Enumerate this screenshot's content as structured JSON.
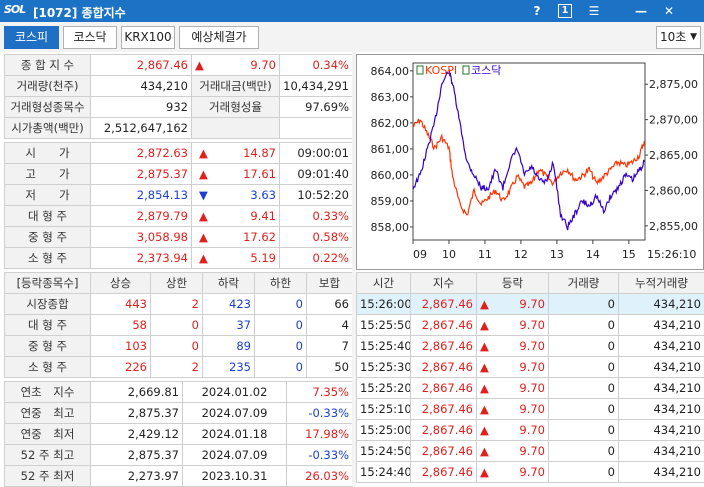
{
  "titlebar": {
    "logo": "SOL",
    "title": "[1072] 종합지수",
    "help": "?",
    "box": "1",
    "menu": "☰",
    "min": "—",
    "close": "✕"
  },
  "tabs": [
    "코스피",
    "코스닥",
    "KRX100",
    "예상체결가"
  ],
  "interval": "10초",
  "summary": [
    {
      "l1": "종 합 지 수",
      "v1": "2,867.46",
      "arrow": "▲",
      "v2": "9.70",
      "v3": "0.34%"
    },
    {
      "l1": "거래량(천주)",
      "v1": "434,210",
      "l2": "거래대금(백만)",
      "v2": "10,434,291"
    },
    {
      "l1": "거래형성종목수",
      "v1": "932",
      "l2": "거래형성율",
      "v2": "97.69%"
    },
    {
      "l1": "시가총액(백만)",
      "v1": "2,512,647,162"
    }
  ],
  "ohlc": [
    {
      "label": "시　　가",
      "value": "2,872.63",
      "arrow": "▲",
      "diff": "14.87",
      "extra": "09:00:01",
      "vc": "red",
      "ac": "red",
      "xc": ""
    },
    {
      "label": "고　　가",
      "value": "2,875.37",
      "arrow": "▲",
      "diff": "17.61",
      "extra": "09:01:40",
      "vc": "red",
      "ac": "red",
      "xc": ""
    },
    {
      "label": "저　　가",
      "value": "2,854.13",
      "arrow": "▼",
      "diff": "3.63",
      "extra": "10:52:20",
      "vc": "blue",
      "ac": "blue",
      "xc": ""
    },
    {
      "label": "대 형 주",
      "value": "2,879.79",
      "arrow": "▲",
      "diff": "9.41",
      "extra": "0.33%",
      "vc": "red",
      "ac": "red",
      "xc": "red"
    },
    {
      "label": "중 형 주",
      "value": "3,058.98",
      "arrow": "▲",
      "diff": "17.62",
      "extra": "0.58%",
      "vc": "red",
      "ac": "red",
      "xc": "red"
    },
    {
      "label": "소 형 주",
      "value": "2,373.94",
      "arrow": "▲",
      "diff": "5.19",
      "extra": "0.22%",
      "vc": "red",
      "ac": "red",
      "xc": "red"
    }
  ],
  "breadth": {
    "headers": [
      "[등락종목수]",
      "상승",
      "상한",
      "하락",
      "하한",
      "보합"
    ],
    "rows": [
      [
        "시장종합",
        "443",
        "2",
        "423",
        "0",
        "66"
      ],
      [
        "대 형 주",
        "58",
        "0",
        "37",
        "0",
        "4"
      ],
      [
        "중 형 주",
        "103",
        "0",
        "89",
        "0",
        "7"
      ],
      [
        "소 형 주",
        "226",
        "2",
        "235",
        "0",
        "50"
      ]
    ]
  },
  "yearly": [
    {
      "label": "연초　지수",
      "value": "2,669.81",
      "date": "2024.01.02",
      "pct": "7.35%",
      "pc": "red"
    },
    {
      "label": "연중　최고",
      "value": "2,875.37",
      "date": "2024.07.09",
      "pct": "-0.33%",
      "pc": "blue"
    },
    {
      "label": "연중　최저",
      "value": "2,429.12",
      "date": "2024.01.18",
      "pct": "17.98%",
      "pc": "red"
    },
    {
      "label": "52 주 최고",
      "value": "2,875.37",
      "date": "2024.07.09",
      "pct": "-0.33%",
      "pc": "blue"
    },
    {
      "label": "52 주 최저",
      "value": "2,273.97",
      "date": "2023.10.31",
      "pct": "26.03%",
      "pc": "red"
    }
  ],
  "ticks": {
    "headers": [
      "시간",
      "지수",
      "등락",
      "거래량",
      "누적거래량"
    ],
    "rows": [
      [
        "15:26:00",
        "2,867.46",
        "▲",
        "9.70",
        "0",
        "434,210"
      ],
      [
        "15:25:50",
        "2,867.46",
        "▲",
        "9.70",
        "0",
        "434,210"
      ],
      [
        "15:25:40",
        "2,867.46",
        "▲",
        "9.70",
        "0",
        "434,210"
      ],
      [
        "15:25:30",
        "2,867.46",
        "▲",
        "9.70",
        "0",
        "434,210"
      ],
      [
        "15:25:20",
        "2,867.46",
        "▲",
        "9.70",
        "0",
        "434,210"
      ],
      [
        "15:25:10",
        "2,867.46",
        "▲",
        "9.70",
        "0",
        "434,210"
      ],
      [
        "15:25:00",
        "2,867.46",
        "▲",
        "9.70",
        "0",
        "434,210"
      ],
      [
        "15:24:50",
        "2,867.46",
        "▲",
        "9.70",
        "0",
        "434,210"
      ],
      [
        "15:24:40",
        "2,867.46",
        "▲",
        "9.70",
        "0",
        "434,210"
      ]
    ]
  },
  "chart_data": {
    "type": "line",
    "legend": [
      "KOSPI",
      "코스닥"
    ],
    "colors": {
      "kospi": "#ff3300",
      "kosdaq": "#3300cc"
    },
    "left_ticks": [
      "864,00",
      "863,00",
      "862,00",
      "861,00",
      "860,00",
      "859,00",
      "858,00"
    ],
    "right_ticks": [
      "2,875,00",
      "2,870,00",
      "2,865,00",
      "2,860,00",
      "2,855,00"
    ],
    "x_ticks": [
      "09",
      "10",
      "11",
      "12",
      "13",
      "14",
      "15"
    ],
    "x_end": "15:26:10",
    "left_ylim": [
      857.5,
      864.3
    ],
    "right_ylim": [
      2853,
      2878
    ],
    "x_range": [
      9.0,
      15.45
    ],
    "kospi": {
      "x": [
        9.0,
        9.2,
        9.4,
        9.6,
        9.8,
        10.0,
        10.1,
        10.3,
        10.5,
        10.7,
        10.9,
        11.1,
        11.3,
        11.5,
        11.7,
        11.9,
        12.1,
        12.3,
        12.5,
        12.7,
        12.9,
        13.1,
        13.3,
        13.5,
        13.7,
        13.9,
        14.1,
        14.3,
        14.5,
        14.7,
        14.9,
        15.1,
        15.3,
        15.43
      ],
      "y": [
        2869,
        2870,
        2868,
        2866,
        2867.5,
        2866,
        2862,
        2858,
        2856.5,
        2860,
        2858,
        2859,
        2860,
        2858.5,
        2860,
        2862,
        2860.5,
        2861,
        2863,
        2862,
        2861,
        2862.5,
        2863,
        2861.5,
        2862,
        2863,
        2861,
        2862,
        2863,
        2864,
        2863.5,
        2864,
        2865,
        2867
      ]
    },
    "kosdaq": {
      "x": [
        9.0,
        9.2,
        9.4,
        9.6,
        9.8,
        10.0,
        10.1,
        10.3,
        10.5,
        10.7,
        10.9,
        11.1,
        11.3,
        11.5,
        11.7,
        11.9,
        12.1,
        12.3,
        12.5,
        12.7,
        12.9,
        13.1,
        13.3,
        13.5,
        13.7,
        13.9,
        14.1,
        14.3,
        14.5,
        14.7,
        14.9,
        15.1,
        15.3,
        15.43
      ],
      "y": [
        859.5,
        860,
        861,
        862,
        863.5,
        864,
        863.5,
        862,
        860.5,
        860,
        859.5,
        859.5,
        860.2,
        859.5,
        860.5,
        861,
        860,
        860.3,
        859.8,
        859.7,
        860.5,
        858.5,
        858,
        858.5,
        859,
        858.8,
        859.2,
        858.6,
        859.2,
        859.5,
        860,
        859.8,
        860.2,
        860.5
      ]
    }
  }
}
